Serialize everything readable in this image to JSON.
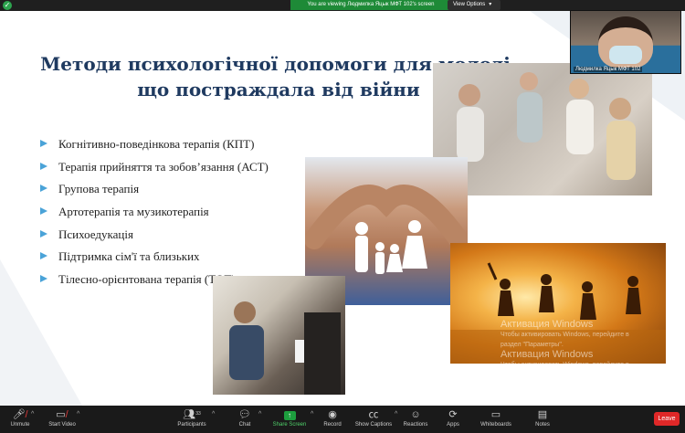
{
  "topbar": {
    "viewing_text": "You are viewing Людмилка Яцык МФТ 102's screen",
    "view_options_label": "View Options",
    "view_options_chevron": "▾",
    "security_icon": "shield-check-icon",
    "security_color": "#2da44e",
    "banner_color": "#1e8a37"
  },
  "slide": {
    "title_line1": "Методи психологічної допомоги для молоді,",
    "title_line2": "що постраждала від війни",
    "title_color": "#1f3a60",
    "bullet_color": "#4aa3d8",
    "bullets": [
      "Когнітивно-поведінкова терапія (КПТ)",
      "Терапія прийняття та зобов’язання (АСТ)",
      "Групова терапія",
      "Артотерапія та музикотерапія",
      "Психоедукація",
      "Підтримка сім'ї та близьких",
      "Тілесно-орієнтована терапія (ТОТ)"
    ],
    "watermark": {
      "title": "Активация Windows",
      "line1": "Чтобы активировать Windows, перейдите в",
      "line2": "раздел \"Параметры\".",
      "title2": "Активация Windows",
      "line3": "Чтобы активировать Windows, перейдите в",
      "line4": "раздел \"Параметры\"."
    }
  },
  "selfview": {
    "name": "Людмилка Яцык МФТ 102"
  },
  "toolbar": {
    "unmute_label": "Unmute",
    "start_video_label": "Start Video",
    "participants_label": "Participants",
    "participants_count": "33",
    "chat_label": "Chat",
    "share_screen_label": "Share Screen",
    "record_label": "Record",
    "show_captions_label": "Show Captions",
    "reactions_label": "Reactions",
    "apps_label": "Apps",
    "whiteboards_label": "Whiteboards",
    "notes_label": "Notes",
    "leave_label": "Leave",
    "leave_color": "#e02828",
    "share_color": "#1d9e3e",
    "caret": "^"
  }
}
